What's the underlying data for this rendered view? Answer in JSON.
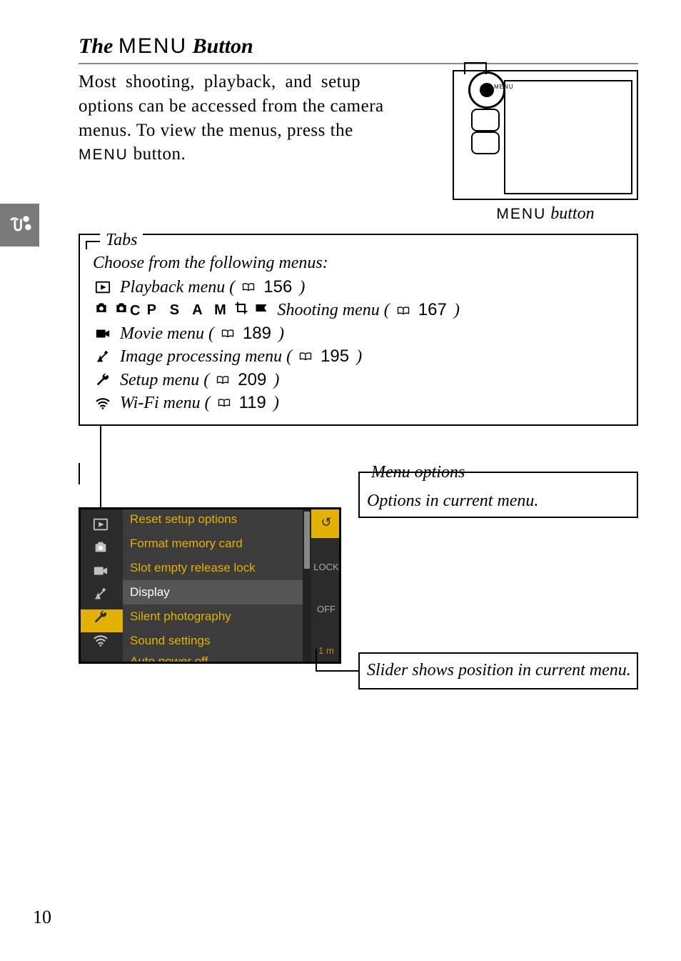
{
  "heading": {
    "prefix": "The",
    "menu": "MENU",
    "suffix": "Button"
  },
  "intro": {
    "line1": "Most shooting, playback, and setup",
    "line2": "options can be accessed from the camera",
    "line3": "menus.  To view the menus, press the",
    "menu_word": "MENU",
    "line4_suffix": " button."
  },
  "camera_caption": {
    "menu": "MENU",
    "text": " button"
  },
  "tabs": {
    "label": "Tabs",
    "choose": "Choose from the following menus:",
    "rows": [
      {
        "glyph": "play",
        "text": "Playback menu (",
        "page": "156",
        "close": ")"
      },
      {
        "glyph": "modes",
        "text": " Shooting menu (",
        "page": "167",
        "close": ")"
      },
      {
        "glyph": "movie",
        "text": "Movie menu (",
        "page": "189",
        "close": ")"
      },
      {
        "glyph": "retouch",
        "text": "Image processing menu (",
        "page": "195",
        "close": ")"
      },
      {
        "glyph": "wrench",
        "text": "Setup menu (",
        "page": "209",
        "close": ")"
      },
      {
        "glyph": "wifi",
        "text": "Wi-Fi menu (",
        "page": "119",
        "close": ")"
      }
    ],
    "modes": {
      "letters": [
        "P",
        "S",
        "A",
        "M"
      ],
      "cc": "C"
    }
  },
  "menu_options": {
    "label": "Menu options",
    "text": "Options in current menu."
  },
  "slider_callout": "Slider shows position in current menu.",
  "menu_screen": {
    "items": [
      {
        "label": "Reset setup options",
        "value": "↺",
        "cls": "top"
      },
      {
        "label": "Format memory card",
        "value": ""
      },
      {
        "label": "Slot empty release lock",
        "value": "LOCK"
      },
      {
        "label": "Display",
        "value": ""
      },
      {
        "label": "Silent photography",
        "value": "OFF"
      },
      {
        "label": "Sound settings",
        "value": ""
      },
      {
        "label": "Auto power off",
        "value": "1 m",
        "cls": "bot"
      }
    ],
    "selected_index": 3
  },
  "page_number": "10"
}
